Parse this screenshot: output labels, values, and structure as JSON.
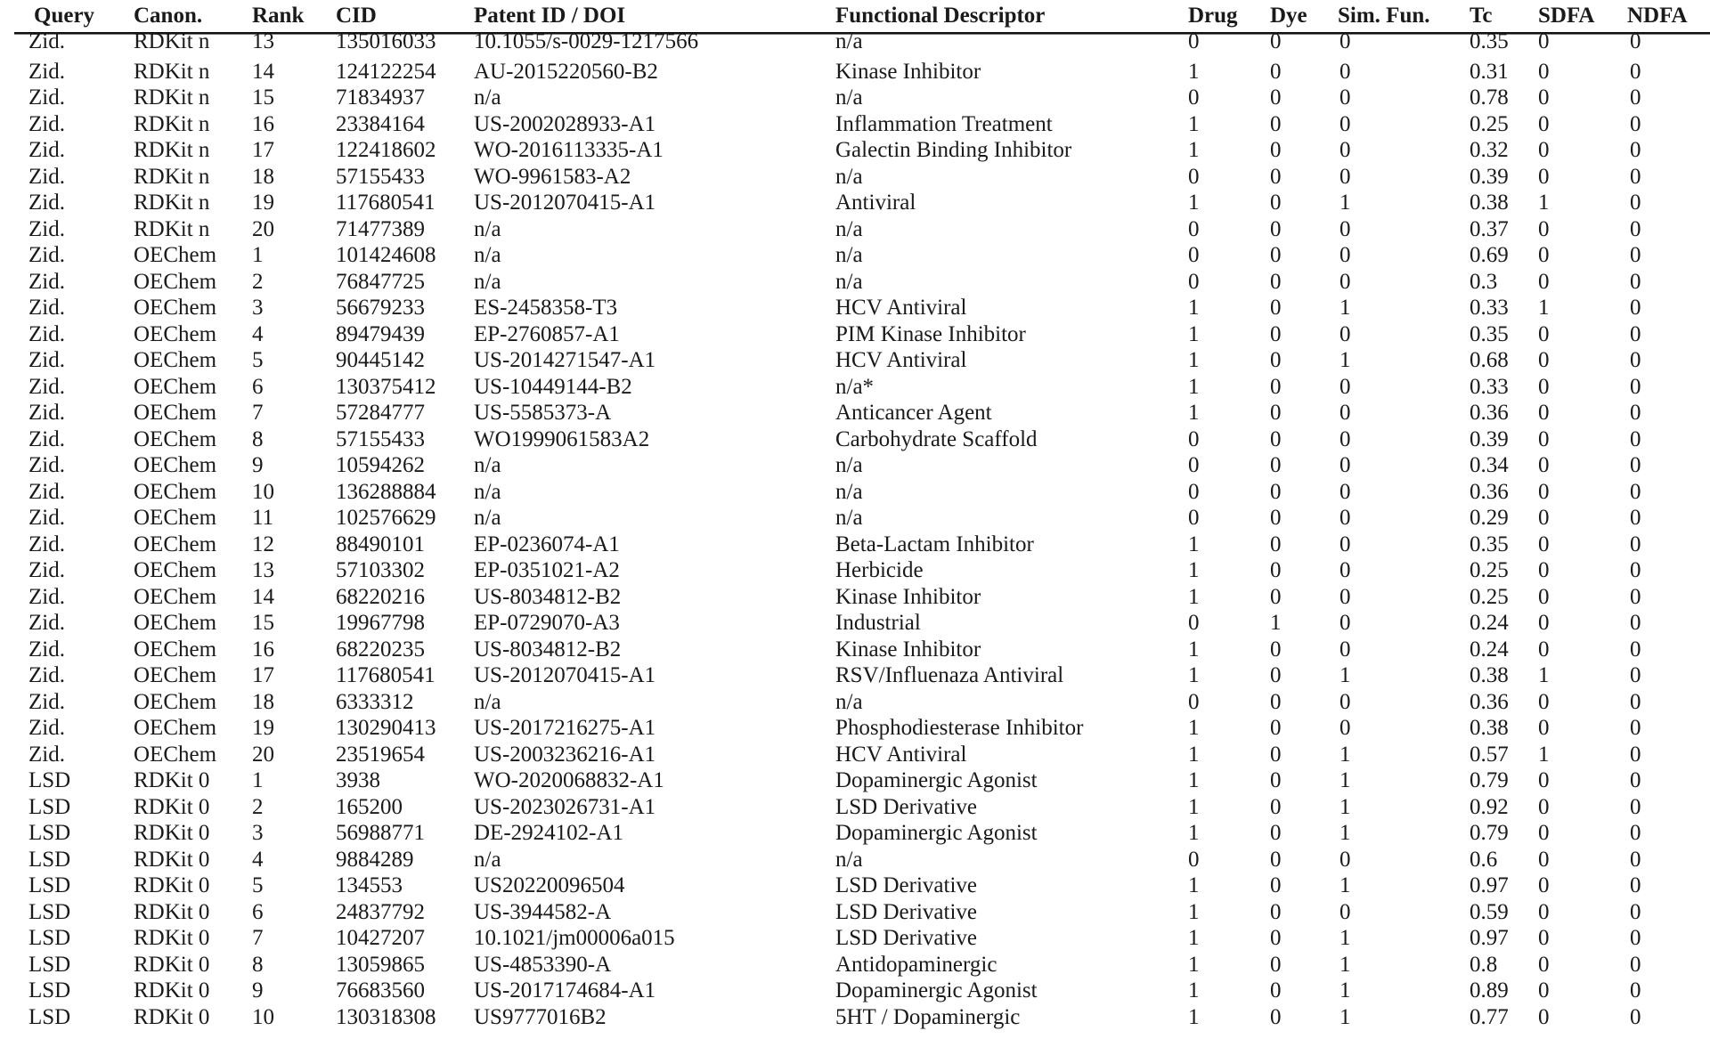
{
  "table": {
    "headers": [
      "Query",
      "Canon.",
      "Rank",
      "CID",
      "Patent ID / DOI",
      "Functional Descriptor",
      "Drug",
      "Dye",
      "Sim. Fun.",
      "Tc",
      "SDFA",
      "NDFA"
    ],
    "rows": [
      [
        "Zid.",
        "RDKit n",
        "13",
        "135016033",
        "10.1055/s-0029-1217566",
        "n/a",
        "0",
        "0",
        "0",
        "0.35",
        "0",
        "0"
      ],
      [
        "Zid.",
        "RDKit n",
        "14",
        "124122254",
        "AU-2015220560-B2",
        "Kinase Inhibitor",
        "1",
        "0",
        "0",
        "0.31",
        "0",
        "0"
      ],
      [
        "Zid.",
        "RDKit n",
        "15",
        "71834937",
        "n/a",
        "n/a",
        "0",
        "0",
        "0",
        "0.78",
        "0",
        "0"
      ],
      [
        "Zid.",
        "RDKit n",
        "16",
        "23384164",
        "US-2002028933-A1",
        "Inflammation Treatment",
        "1",
        "0",
        "0",
        "0.25",
        "0",
        "0"
      ],
      [
        "Zid.",
        "RDKit n",
        "17",
        "122418602",
        "WO-2016113335-A1",
        "Galectin Binding Inhibitor",
        "1",
        "0",
        "0",
        "0.32",
        "0",
        "0"
      ],
      [
        "Zid.",
        "RDKit n",
        "18",
        "57155433",
        "WO-9961583-A2",
        "n/a",
        "0",
        "0",
        "0",
        "0.39",
        "0",
        "0"
      ],
      [
        "Zid.",
        "RDKit n",
        "19",
        "117680541",
        "US-2012070415-A1",
        "Antiviral",
        "1",
        "0",
        "1",
        "0.38",
        "1",
        "0"
      ],
      [
        "Zid.",
        "RDKit n",
        "20",
        "71477389",
        "n/a",
        "n/a",
        "0",
        "0",
        "0",
        "0.37",
        "0",
        "0"
      ],
      [
        "Zid.",
        "OEChem",
        "1",
        "101424608",
        "n/a",
        "n/a",
        "0",
        "0",
        "0",
        "0.69",
        "0",
        "0"
      ],
      [
        "Zid.",
        "OEChem",
        "2",
        "76847725",
        "n/a",
        "n/a",
        "0",
        "0",
        "0",
        "0.3",
        "0",
        "0"
      ],
      [
        "Zid.",
        "OEChem",
        "3",
        "56679233",
        "ES-2458358-T3",
        "HCV Antiviral",
        "1",
        "0",
        "1",
        "0.33",
        "1",
        "0"
      ],
      [
        "Zid.",
        "OEChem",
        "4",
        "89479439",
        "EP-2760857-A1",
        "PIM Kinase Inhibitor",
        "1",
        "0",
        "0",
        "0.35",
        "0",
        "0"
      ],
      [
        "Zid.",
        "OEChem",
        "5",
        "90445142",
        "US-2014271547-A1",
        "HCV Antiviral",
        "1",
        "0",
        "1",
        "0.68",
        "0",
        "0"
      ],
      [
        "Zid.",
        "OEChem",
        "6",
        "130375412",
        "US-10449144-B2",
        "n/a*",
        "1",
        "0",
        "0",
        "0.33",
        "0",
        "0"
      ],
      [
        "Zid.",
        "OEChem",
        "7",
        "57284777",
        "US-5585373-A",
        "Anticancer Agent",
        "1",
        "0",
        "0",
        "0.36",
        "0",
        "0"
      ],
      [
        "Zid.",
        "OEChem",
        "8",
        "57155433",
        "WO1999061583A2",
        "Carbohydrate Scaffold",
        "0",
        "0",
        "0",
        "0.39",
        "0",
        "0"
      ],
      [
        "Zid.",
        "OEChem",
        "9",
        "10594262",
        "n/a",
        "n/a",
        "0",
        "0",
        "0",
        "0.34",
        "0",
        "0"
      ],
      [
        "Zid.",
        "OEChem",
        "10",
        "136288884",
        "n/a",
        "n/a",
        "0",
        "0",
        "0",
        "0.36",
        "0",
        "0"
      ],
      [
        "Zid.",
        "OEChem",
        "11",
        "102576629",
        "n/a",
        "n/a",
        "0",
        "0",
        "0",
        "0.29",
        "0",
        "0"
      ],
      [
        "Zid.",
        "OEChem",
        "12",
        "88490101",
        "EP-0236074-A1",
        "Beta-Lactam Inhibitor",
        "1",
        "0",
        "0",
        "0.35",
        "0",
        "0"
      ],
      [
        "Zid.",
        "OEChem",
        "13",
        "57103302",
        "EP-0351021-A2",
        "Herbicide",
        "1",
        "0",
        "0",
        "0.25",
        "0",
        "0"
      ],
      [
        "Zid.",
        "OEChem",
        "14",
        "68220216",
        "US-8034812-B2",
        "Kinase Inhibitor",
        "1",
        "0",
        "0",
        "0.25",
        "0",
        "0"
      ],
      [
        "Zid.",
        "OEChem",
        "15",
        "19967798",
        "EP-0729070-A3",
        "Industrial",
        "0",
        "1",
        "0",
        "0.24",
        "0",
        "0"
      ],
      [
        "Zid.",
        "OEChem",
        "16",
        "68220235",
        "US-8034812-B2",
        "Kinase Inhibitor",
        "1",
        "0",
        "0",
        "0.24",
        "0",
        "0"
      ],
      [
        "Zid.",
        "OEChem",
        "17",
        "117680541",
        "US-2012070415-A1",
        "RSV/Influenaza Antiviral",
        "1",
        "0",
        "1",
        "0.38",
        "1",
        "0"
      ],
      [
        "Zid.",
        "OEChem",
        "18",
        "6333312",
        "n/a",
        "n/a",
        "0",
        "0",
        "0",
        "0.36",
        "0",
        "0"
      ],
      [
        "Zid.",
        "OEChem",
        "19",
        "130290413",
        "US-2017216275-A1",
        "Phosphodiesterase Inhibitor",
        "1",
        "0",
        "0",
        "0.38",
        "0",
        "0"
      ],
      [
        "Zid.",
        "OEChem",
        "20",
        "23519654",
        "US-2003236216-A1",
        "HCV Antiviral",
        "1",
        "0",
        "1",
        "0.57",
        "1",
        "0"
      ],
      [
        "LSD",
        "RDKit 0",
        "1",
        "3938",
        "WO-2020068832-A1",
        "Dopaminergic Agonist",
        "1",
        "0",
        "1",
        "0.79",
        "0",
        "0"
      ],
      [
        "LSD",
        "RDKit 0",
        "2",
        "165200",
        "US-2023026731-A1",
        "LSD Derivative",
        "1",
        "0",
        "1",
        "0.92",
        "0",
        "0"
      ],
      [
        "LSD",
        "RDKit 0",
        "3",
        "56988771",
        "DE-2924102-A1",
        "Dopaminergic Agonist",
        "1",
        "0",
        "1",
        "0.79",
        "0",
        "0"
      ],
      [
        "LSD",
        "RDKit 0",
        "4",
        "9884289",
        "n/a",
        "n/a",
        "0",
        "0",
        "0",
        "0.6",
        "0",
        "0"
      ],
      [
        "LSD",
        "RDKit 0",
        "5",
        "134553",
        "US20220096504",
        "LSD Derivative",
        "1",
        "0",
        "1",
        "0.97",
        "0",
        "0"
      ],
      [
        "LSD",
        "RDKit 0",
        "6",
        "24837792",
        "US-3944582-A",
        "LSD Derivative",
        "1",
        "0",
        "0",
        "0.59",
        "0",
        "0"
      ],
      [
        "LSD",
        "RDKit 0",
        "7",
        "10427207",
        "10.1021/jm00006a015",
        "LSD Derivative",
        "1",
        "0",
        "1",
        "0.97",
        "0",
        "0"
      ],
      [
        "LSD",
        "RDKit 0",
        "8",
        "13059865",
        "US-4853390-A",
        "Antidopaminergic",
        "1",
        "0",
        "1",
        "0.8",
        "0",
        "0"
      ],
      [
        "LSD",
        "RDKit 0",
        "9",
        "76683560",
        "US-2017174684-A1",
        "Dopaminergic Agonist",
        "1",
        "0",
        "1",
        "0.89",
        "0",
        "0"
      ],
      [
        "LSD",
        "RDKit 0",
        "10",
        "130318308",
        "US9777016B2",
        "5HT / Dopaminergic",
        "1",
        "0",
        "1",
        "0.77",
        "0",
        "0"
      ]
    ]
  }
}
